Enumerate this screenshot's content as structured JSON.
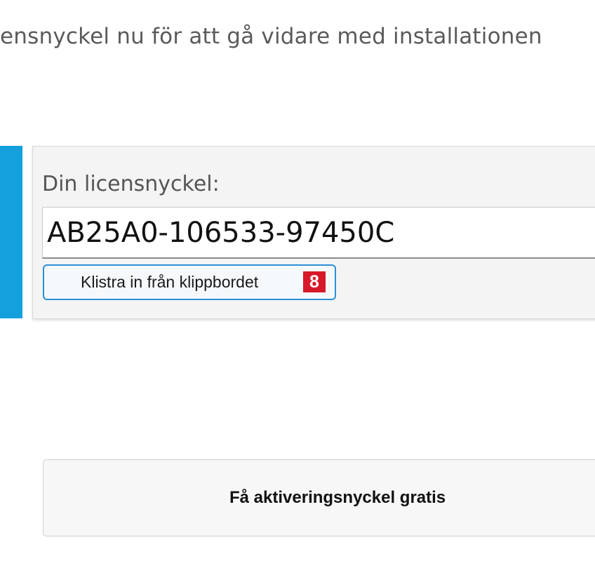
{
  "instruction": {
    "text": "ensnyckel nu för att gå vidare med installationen"
  },
  "license": {
    "label": "Din licensnyckel:",
    "value": "AB25A0-106533-97450C",
    "paste_button_label": "Klistra in från klippbordet",
    "step_badge": "8"
  },
  "activation": {
    "button_label": "Få aktiveringsnyckel gratis"
  },
  "colors": {
    "accent": "#14a0dc",
    "badge": "#d7182a",
    "button_border": "#2b8fd4"
  }
}
